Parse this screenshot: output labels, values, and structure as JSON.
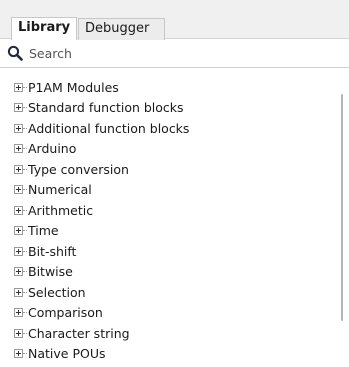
{
  "tabs": [
    {
      "label": "Library"
    },
    {
      "label": "Debugger"
    }
  ],
  "search": {
    "placeholder": "Search",
    "icon": "search-icon"
  },
  "tree": {
    "items": [
      {
        "label": "P1AM Modules"
      },
      {
        "label": "Standard function blocks"
      },
      {
        "label": "Additional function blocks"
      },
      {
        "label": "Arduino"
      },
      {
        "label": "Type conversion"
      },
      {
        "label": "Numerical"
      },
      {
        "label": "Arithmetic"
      },
      {
        "label": "Time"
      },
      {
        "label": "Bit-shift"
      },
      {
        "label": "Bitwise"
      },
      {
        "label": "Selection"
      },
      {
        "label": "Comparison"
      },
      {
        "label": "Character string"
      },
      {
        "label": "Native POUs"
      }
    ]
  }
}
